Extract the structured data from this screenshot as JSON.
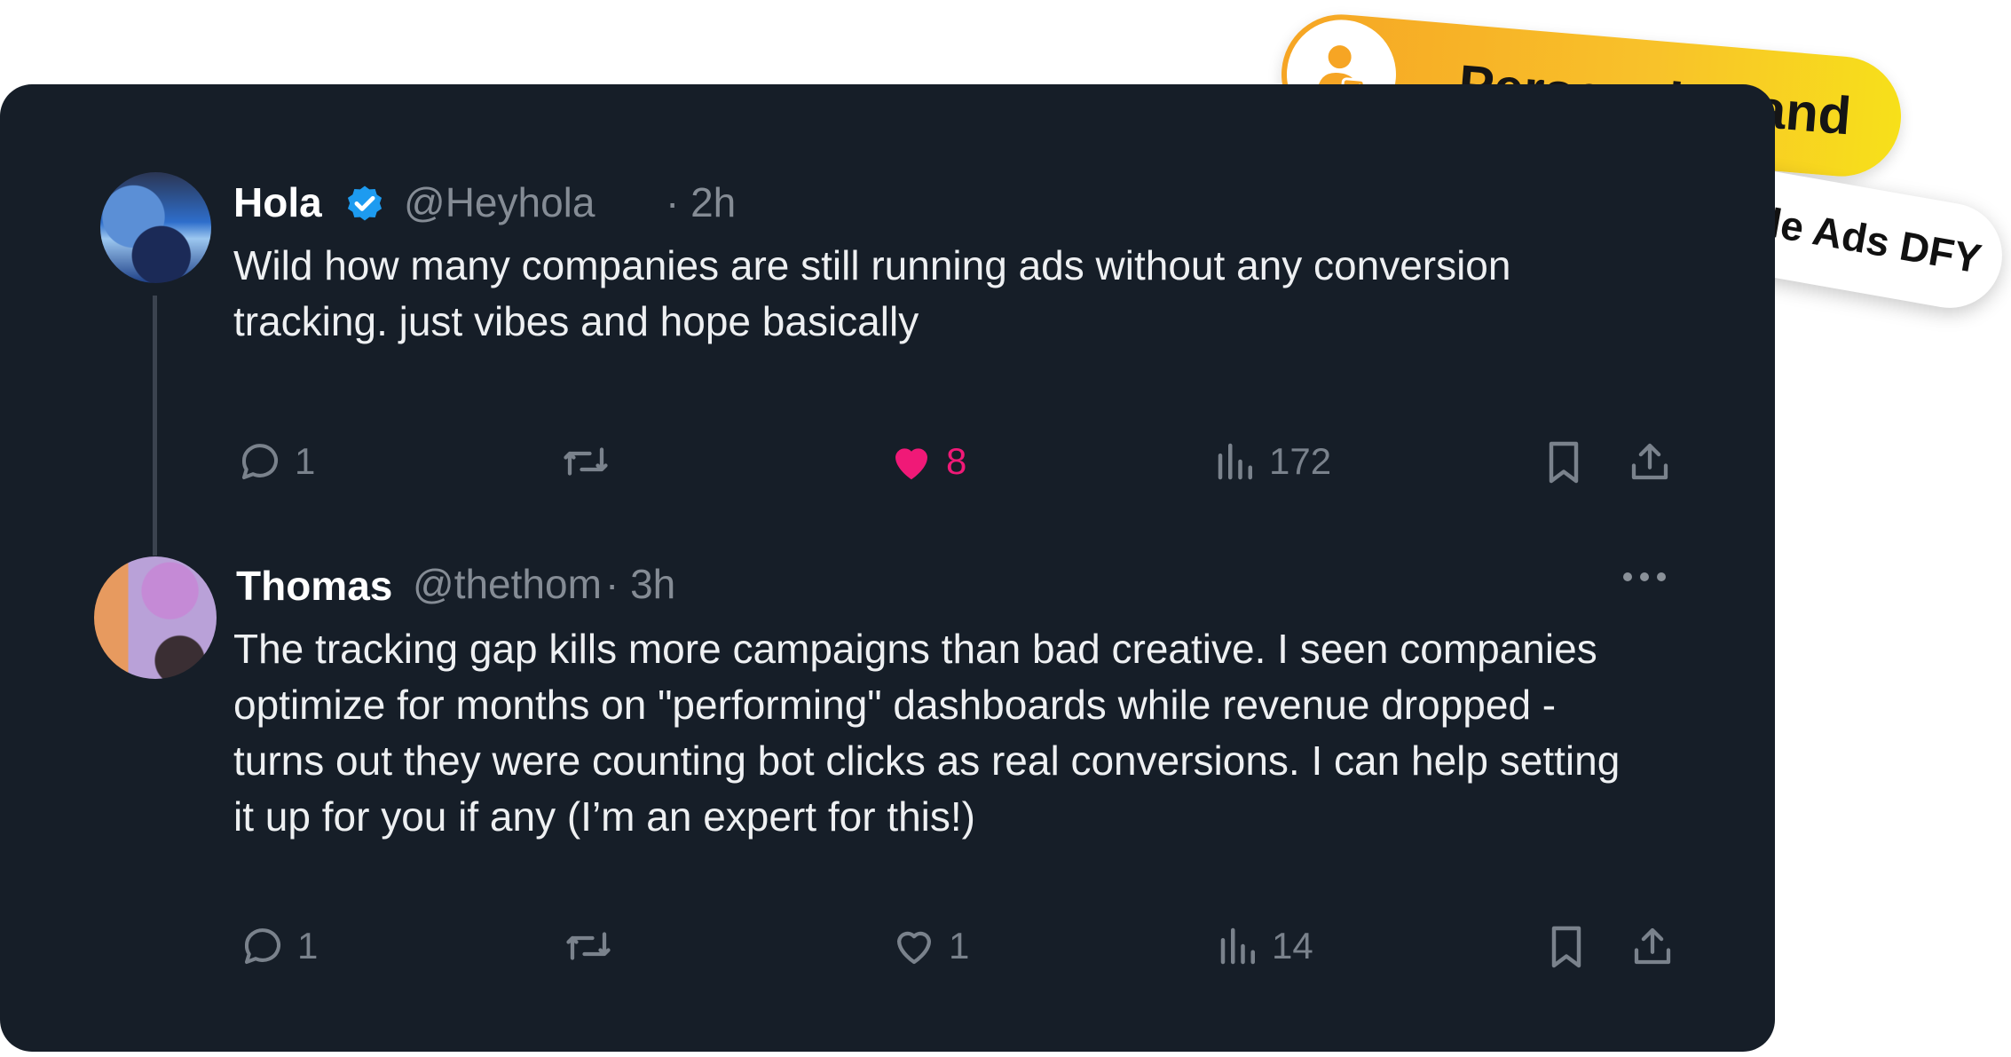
{
  "badges": {
    "personal_brand": "Personal Brand",
    "google_ads": "Google Ads DFY"
  },
  "tweets": [
    {
      "name": "Hola",
      "verified": true,
      "handle": "@Heyhola",
      "time": "· 2h",
      "text_lines": [
        "Wild how many companies are still running ads without any conversion",
        "tracking. just vibes and hope basically"
      ],
      "replies": "1",
      "likes": "8",
      "liked": true,
      "views": "172"
    },
    {
      "name": "Thomas",
      "verified": false,
      "handle": "@thethom",
      "time": "· 3h",
      "text_lines": [
        "The tracking gap kills more campaigns than bad creative. I seen companies",
        "optimize for months on \"performing\" dashboards while revenue dropped -",
        "turns out they were counting bot clicks as real conversions. I can help setting",
        "it up for you if any (I’m an expert for this!)"
      ],
      "replies": "1",
      "likes": "1",
      "liked": false,
      "views": "14"
    }
  ],
  "icons": {
    "reply": "speech-bubble-icon",
    "retweet": "retweet-icon",
    "like": "heart-icon",
    "views": "bar-chart-icon",
    "bookmark": "bookmark-icon",
    "share": "share-upload-icon",
    "verified": "verified-badge-icon",
    "more": "more-dots-icon"
  },
  "colors": {
    "card_bg": "#161e28",
    "like_active": "#f01977",
    "verified_blue": "#1d9bf0",
    "muted": "#858c95"
  }
}
